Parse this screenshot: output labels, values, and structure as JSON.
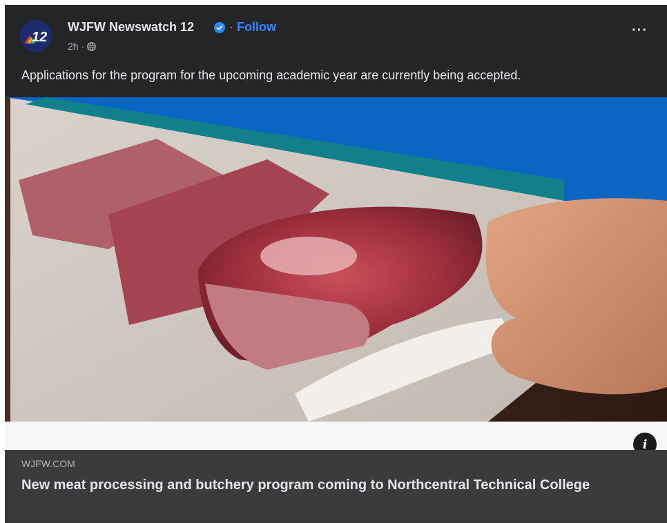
{
  "post": {
    "page_name": "WJFW Newswatch 12",
    "separator": "·",
    "follow_label": "Follow",
    "time": "2h",
    "meta_separator": "·",
    "avatar_text": "12",
    "more_label": "···",
    "caption": "Applications for the program for the upcoming academic year are currently being accepted."
  },
  "link_preview": {
    "domain": "WJFW.COM",
    "title": "New meat processing and butchery program coming to Northcentral Technical College",
    "info_label": "i"
  },
  "icons": {
    "verified": "verified-badge-icon",
    "globe": "globe-icon",
    "more": "more-options-icon",
    "info": "info-icon"
  },
  "colors": {
    "card_bg": "#242526",
    "link_bar_bg": "#3a3b3c",
    "accent_blue": "#2d88ff",
    "banner_blue": "#0a66c2",
    "banner_teal": "#11808a"
  }
}
